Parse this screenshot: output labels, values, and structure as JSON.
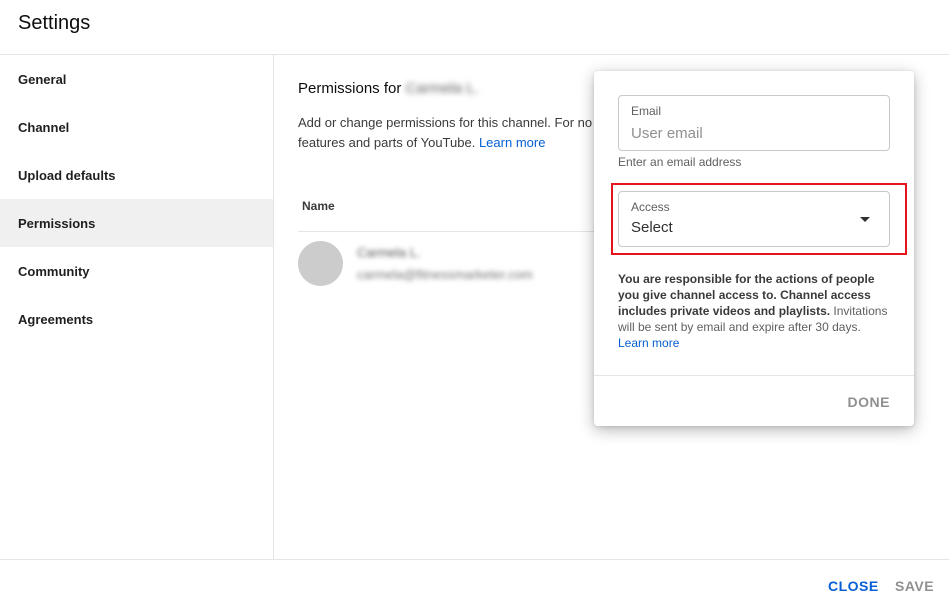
{
  "header": {
    "title": "Settings"
  },
  "sidebar": {
    "items": [
      {
        "label": "General"
      },
      {
        "label": "Channel"
      },
      {
        "label": "Upload defaults"
      },
      {
        "label": "Permissions",
        "active": true
      },
      {
        "label": "Community"
      },
      {
        "label": "Agreements"
      }
    ]
  },
  "main": {
    "title_prefix": "Permissions for",
    "channel_name": "Carmela L.",
    "description_line1": "Add or change permissions for this channel. For no",
    "description_line2": "features and parts of YouTube.",
    "learn_more": "Learn more",
    "name_column": "Name",
    "user": {
      "name": "Carmela L.",
      "email": "carmela@fitnessmarketer.com"
    }
  },
  "dialog": {
    "email_label": "Email",
    "email_placeholder": "User email",
    "email_hint": "Enter an email address",
    "access_label": "Access",
    "access_value": "Select",
    "notice_bold": "You are responsible for the actions of people you give channel access to. Channel access includes private videos and playlists.",
    "notice_text": " Invitations will be sent by email and expire after 30 days. ",
    "notice_link": "Learn more",
    "done_label": "DONE"
  },
  "footer": {
    "close_label": "CLOSE",
    "save_label": "SAVE"
  },
  "colors": {
    "accent": "#065fd4",
    "highlight": "#e5141c",
    "active_bg": "#f0f0f0"
  }
}
